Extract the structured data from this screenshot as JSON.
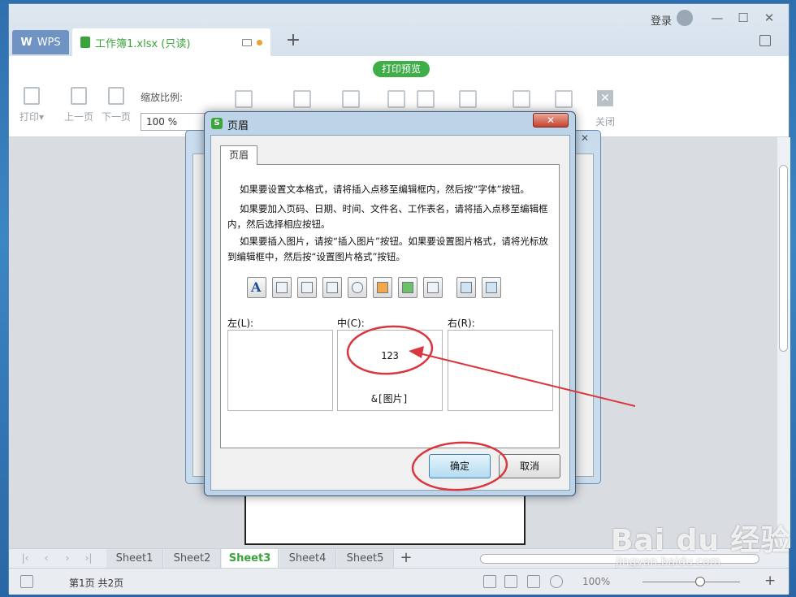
{
  "titlebar": {
    "app_tab": "WPS",
    "doc_tab": "工作簿1.xlsx (只读)",
    "login": "登录"
  },
  "toolbar": {
    "preview_badge": "打印预览",
    "print": "打印",
    "prev_page": "上一页",
    "next_page": "下一页",
    "zoom_label": "缩放比例:",
    "zoom_value": "100 %",
    "close": "关闭"
  },
  "dialog": {
    "title": "页眉",
    "tab": "页眉",
    "instructions": [
      "如果要设置文本格式，请将插入点移至编辑框内，然后按“字体”按钮。",
      "如果要加入页码、日期、时间、文件名、工作表名，请将插入点移至编辑框内，然后选择相应按钮。",
      "如果要插入图片，请按“插入图片”按钮。如果要设置图片格式，请将光标放到编辑框中，然后按“设置图片格式”按钮。"
    ],
    "insert_buttons": [
      {
        "icon": "font-icon",
        "glyph": "A"
      },
      {
        "icon": "page-number-icon"
      },
      {
        "icon": "total-pages-icon"
      },
      {
        "icon": "date-icon"
      },
      {
        "icon": "time-icon"
      },
      {
        "icon": "file-name-icon"
      },
      {
        "icon": "sheet-name-icon"
      },
      {
        "icon": "file-path-icon"
      },
      {
        "icon": "insert-picture-icon"
      },
      {
        "icon": "format-picture-icon"
      }
    ],
    "left_label": "左(L):",
    "center_label": "中(C):",
    "right_label": "右(R):",
    "left_content": "",
    "center_line1": "123",
    "center_line2": "&[图片]",
    "right_content": "",
    "ok": "确定",
    "cancel": "取消"
  },
  "sheets": {
    "tabs": [
      "Sheet1",
      "Sheet2",
      "Sheet3",
      "Sheet4",
      "Sheet5"
    ],
    "active": "Sheet3"
  },
  "status": {
    "page_info": "第1页 共2页",
    "zoom": "100%"
  },
  "watermark": {
    "brand": "Bai du 经验",
    "url": "jingyan.baidu.com"
  },
  "colors": {
    "accent_green": "#3ba43b",
    "annotation_red": "#d9363e"
  }
}
